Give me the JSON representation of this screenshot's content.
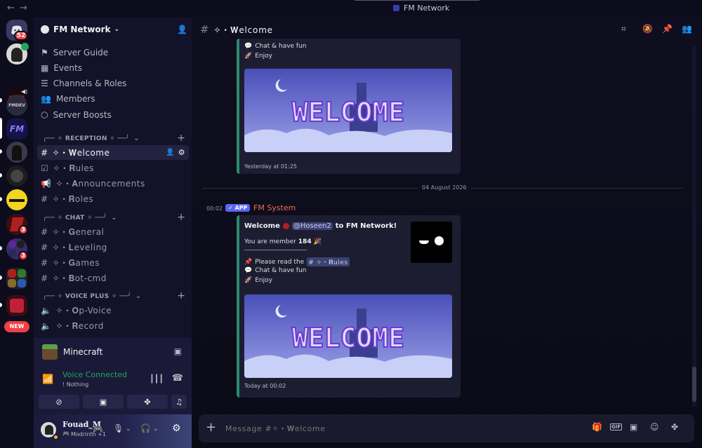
{
  "window": {
    "title": "FM Network",
    "back": "←",
    "forward": "→"
  },
  "rail": {
    "dm_badge": "52",
    "badges": [
      "3",
      "3"
    ],
    "server_label_fmdev": "FMDEV",
    "new_label": "NEW"
  },
  "server": {
    "name": "FM Network"
  },
  "nav": [
    {
      "label": "Server Guide",
      "icon": "signpost-icon"
    },
    {
      "label": "Events",
      "icon": "calendar-icon"
    },
    {
      "label": "Channels & Roles",
      "icon": "list-icon"
    },
    {
      "label": "Members",
      "icon": "members-icon"
    },
    {
      "label": "Server Boosts",
      "icon": "boost-icon"
    }
  ],
  "categories": {
    "reception": "╭── ✧ RECEPTION ✧ ──╯",
    "chat": "╭── ✧ CHAT ✧ ──╯",
    "voice": "╭── ✧ VOICE PLUS ✧ ──╯"
  },
  "channels": {
    "welcome": "✧・𝐖elcome",
    "rules": "✧・𝐑ules",
    "announcements": "✧・𝐀nnouncements",
    "roles": "✧・𝐑oles",
    "general": "✧・𝐆eneral",
    "leveling": "✧・𝐋eveling",
    "games": "✧・𝐆ames",
    "bot_cmd": "✧・𝐁ot-cmd",
    "op_voice": "✧・𝐎p-Voice",
    "record": "✧・𝐑ecord"
  },
  "activity": {
    "game": "Minecraft",
    "voice_status": "Voice Connected",
    "voice_channel": "! Nothing"
  },
  "user": {
    "name": "Fouad_M",
    "status": "Modrinth +1"
  },
  "chat": {
    "channel_title": "✧・𝐖elcome",
    "date_divider": "04 August 2026",
    "placeholder": "Message #✧・𝐖elcome",
    "message1": {
      "line_chat": "Chat & have fun",
      "line_enjoy": "Enjoy",
      "image_text": "WELCOME",
      "footer": "Yesterday at 01:25"
    },
    "message2": {
      "time": "00:02",
      "app_tag": "✓ APP",
      "author": "FM System",
      "welcome_prefix": "Welcome",
      "mention": "@Hoseen2",
      "welcome_suffix": "to FM Network!",
      "member_prefix": "You are member",
      "member_number": "184",
      "separator": "--------------------------------------------",
      "rules_prefix": "Please read the",
      "rules_channel": "# ✧・𝐑ules",
      "line_chat": "Chat & have fun",
      "line_enjoy": "Enjoy",
      "image_text": "WELCOME",
      "footer": "Today at 00:02"
    }
  },
  "colors": {
    "accent": "#5865f2",
    "author": "#f26c4f",
    "embed_border": "#2b8a6e",
    "voice_green": "#23a55a"
  }
}
